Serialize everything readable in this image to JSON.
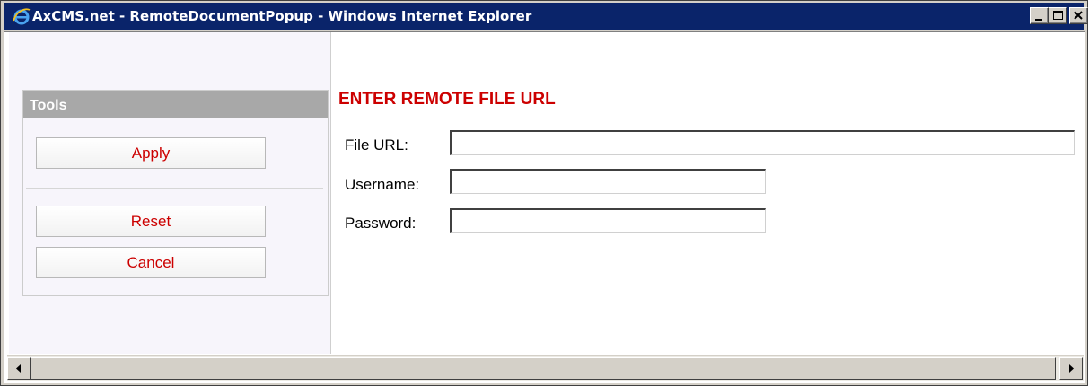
{
  "window": {
    "title": "AxCMS.net - RemoteDocumentPopup - Windows Internet Explorer",
    "title_bar_color": "#0a246a"
  },
  "sidebar": {
    "tools_title": "Tools",
    "buttons": {
      "apply": "Apply",
      "reset": "Reset",
      "cancel": "Cancel"
    },
    "button_text_color": "#cc0000"
  },
  "main": {
    "heading": "ENTER REMOTE FILE URL",
    "fields": {
      "file_url": {
        "label": "File URL:",
        "value": ""
      },
      "username": {
        "label": "Username:",
        "value": ""
      },
      "password": {
        "label": "Password:",
        "value": ""
      }
    },
    "heading_color": "#cc0000"
  },
  "icons": [
    "ie-icon",
    "minimize-icon",
    "maximize-icon",
    "close-icon",
    "scroll-left-icon",
    "scroll-right-icon"
  ]
}
